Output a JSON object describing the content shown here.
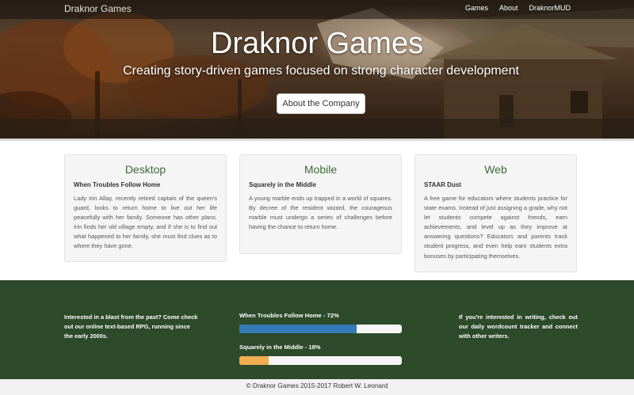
{
  "navbar": {
    "brand": "Draknor Games",
    "links": [
      {
        "label": "Games"
      },
      {
        "label": "About"
      },
      {
        "label": "DraknorMUD"
      }
    ]
  },
  "hero": {
    "title": "Draknor Games",
    "subtitle": "Creating story-driven games focused on strong character development",
    "button_label": "About the Company"
  },
  "cards": [
    {
      "heading": "Desktop",
      "game_title": "When Troubles Follow Home",
      "description": "Lady Irin Allay, recently retired captain of the queen's guard, looks to return home to live out her life peacefully with her family. Someone has other plans. Irin finds her old village empty, and if she is to find out what happened to her family, she must find clues as to where they have gone."
    },
    {
      "heading": "Mobile",
      "game_title": "Squarely in the Middle",
      "description": "A young marble ends up trapped in a world of squares. By decree of the resident wizard, the courageous marble must undergo a series of challenges before having the chance to return home."
    },
    {
      "heading": "Web",
      "game_title": "STAAR Dust",
      "description": "A free game for educators where students practice for state exams. Instead of just assigning a grade, why not let students compete against friends, earn achievements, and level up as they improve at answering questions? Educators and parents track student progress, and even help earn students extra bonuses by participating themselves."
    }
  ],
  "progress_section": {
    "left_text": "Interested in a blast from the past? Come check out our online text-based RPG, running since the early 2000s.",
    "right_text": "If you're interested in writing, check out our daily wordcount tracker and connect with other writers.",
    "bars": [
      {
        "label": "When Troubles Follow Home - 72%",
        "percent": 72,
        "color": "#337ab7"
      },
      {
        "label": "Squarely in the Middle - 18%",
        "percent": 18,
        "color": "#f0ad4e"
      }
    ]
  },
  "footer": {
    "text": "© Draknor Games 2015-2017 Robert W. Leonard"
  }
}
